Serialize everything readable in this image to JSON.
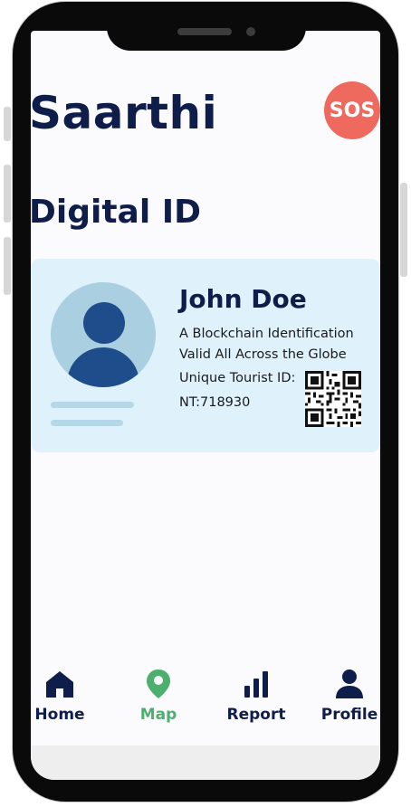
{
  "app": {
    "title": "Saarthi",
    "sos_label": "SOS",
    "section_title": "Digital ID"
  },
  "id_card": {
    "name": "John Doe",
    "description": "A Blockchain Identification Valid All Across the Globe",
    "tourist_id_label": "Unique Tourist ID:",
    "tourist_id_value": "NT:718930",
    "qr_icon": "qr-code"
  },
  "nav": {
    "items": [
      {
        "label": "Home",
        "icon": "home-icon",
        "active": false
      },
      {
        "label": "Map",
        "icon": "map-pin-icon",
        "active": true
      },
      {
        "label": "Report",
        "icon": "bar-chart-icon",
        "active": false
      },
      {
        "label": "Profile",
        "icon": "person-icon",
        "active": false
      }
    ],
    "active_color": "#4caf6e",
    "inactive_color": "#0f1d4a"
  },
  "colors": {
    "brand_dark": "#0f1d4a",
    "sos": "#ee6a5e",
    "card_bg": "#dff1fb",
    "avatar_fill": "#1f4d8c"
  }
}
